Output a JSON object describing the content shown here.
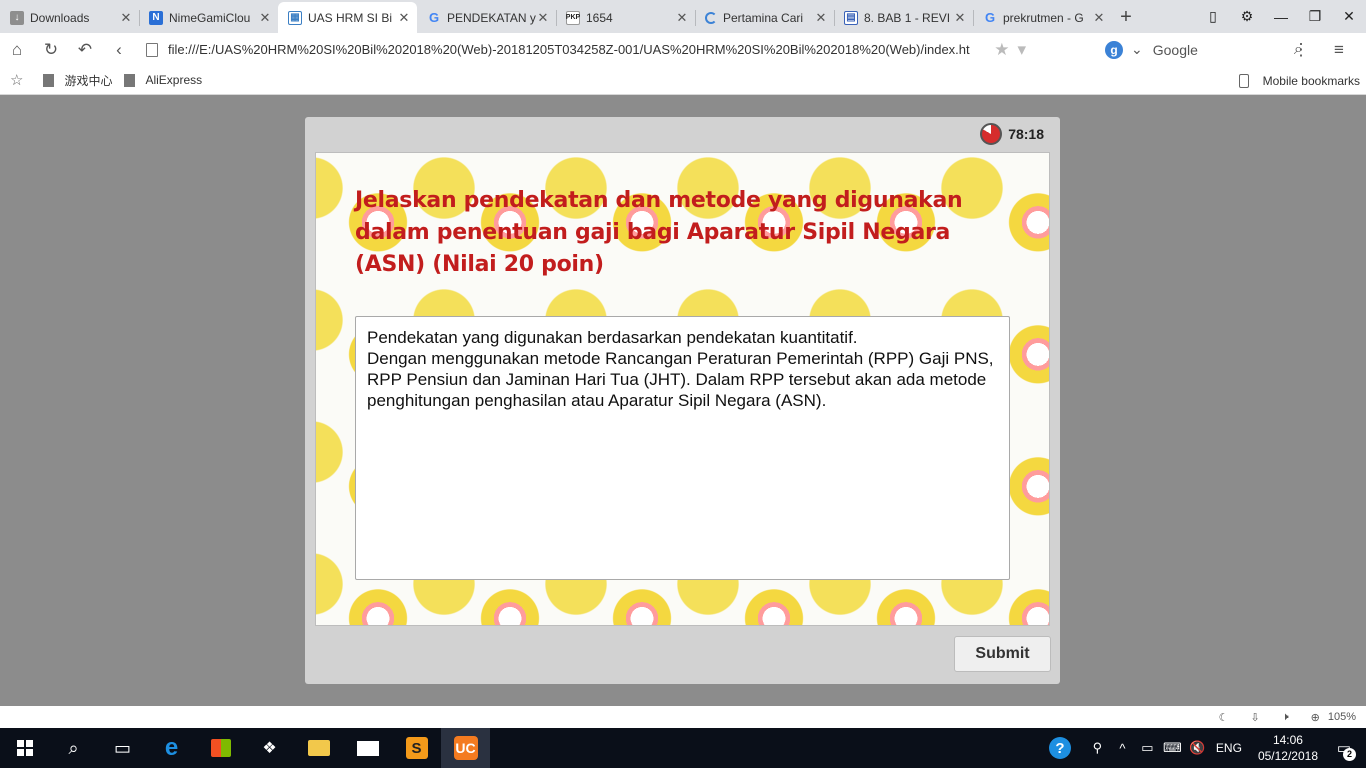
{
  "browser": {
    "tabs": [
      {
        "title": "Downloads",
        "favicon": "downloads-icon",
        "active": false
      },
      {
        "title": "NimeGamiClou",
        "favicon": "n-icon",
        "active": false
      },
      {
        "title": "UAS HRM SI Bi",
        "favicon": "page-icon",
        "active": true
      },
      {
        "title": "PENDEKATAN y",
        "favicon": "google-icon",
        "active": false
      },
      {
        "title": "1654",
        "favicon": "pkp-icon",
        "favicon_text": "PKP",
        "active": false
      },
      {
        "title": "Pertamina Cari",
        "favicon": "loading-icon",
        "active": false
      },
      {
        "title": "8. BAB 1 - REVI",
        "favicon": "document-icon",
        "active": false
      },
      {
        "title": "prekrutmen - G",
        "favicon": "google-icon",
        "active": false
      }
    ],
    "address": "file:///E:/UAS%20HRM%20SI%20Bil%202018%20(Web)-20181205T034258Z-001/UAS%20HRM%20SI%20Bil%202018%20(Web)/index.ht",
    "search_engine": "Google",
    "bookmarks": [
      "游戏中心",
      "AliExpress"
    ],
    "mobile_bookmarks": "Mobile bookmarks"
  },
  "quiz": {
    "timer": "78:18",
    "question": "Jelaskan pendekatan dan metode yang digunakan dalam penentuan gaji bagi Aparatur Sipil Negara (ASN) (Nilai 20 poin)",
    "answer_line1": "Pendekatan yang digunakan berdasarkan pendekatan kuantitatif.",
    "answer_line2": "Dengan menggunakan metode Rancangan Peraturan Pemerintah (RPP) Gaji PNS, RPP Pensiun dan Jaminan Hari Tua (JHT). Dalam RPP tersebut akan ada metode penghitungan penghasilan atau Aparatur Sipil Negara (ASN).",
    "submit_label": "Submit",
    "question_color": "#c21d1d"
  },
  "statusbar": {
    "zoom": "105%"
  },
  "taskbar": {
    "language": "ENG",
    "time": "14:06",
    "date": "05/12/2018",
    "notifications": "2"
  }
}
